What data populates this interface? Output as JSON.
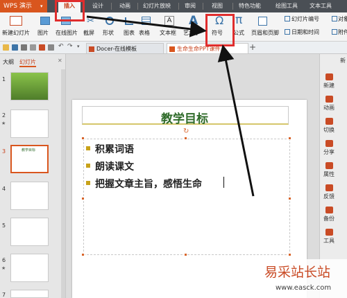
{
  "app": {
    "name": "WPS 演示",
    "dropdown": "▾"
  },
  "ribbon_tabs": [
    "插入",
    "设计",
    "动画",
    "幻灯片放映",
    "审阅",
    "视图",
    "特色功能",
    "绘图工具",
    "文本工具"
  ],
  "ribbon": {
    "new_slide": "新建幻灯片",
    "image": "图片",
    "online_image": "在线图片",
    "screenshot": "截屏",
    "shape": "形状",
    "chart": "图表",
    "table": "表格",
    "textbox": "文本框",
    "art": "艺术字",
    "symbol": "符号",
    "formula": "公式",
    "header_footer": "页眉和页脚",
    "slide_number": "幻灯片编号",
    "date_time": "日期和时间",
    "object": "对象",
    "attachment": "附件"
  },
  "doc_tabs": [
    "Docer-在线模板",
    "生命生命PPT课件..."
  ],
  "left_panel": {
    "tabs": [
      "大纲",
      "幻灯片"
    ],
    "slide_numbers": [
      "1",
      "2",
      "3",
      "4",
      "5",
      "6",
      "7"
    ],
    "thumb3_title": "教学目标"
  },
  "slide": {
    "title": "教学目标",
    "bullets": [
      "积累词语",
      "朗读课文",
      "把握文章主旨，感悟生命"
    ]
  },
  "right_panel": {
    "tab": "新",
    "items": [
      "新建",
      "动画",
      "切换",
      "分享",
      "属性",
      "反馈",
      "备份",
      "工具"
    ]
  },
  "watermark": {
    "line1": "易采站长站",
    "line2": "www.easck.com"
  },
  "colors": {
    "accent": "#d9561e",
    "title_green": "#2f6b2a",
    "annotation_red": "#e02d2d"
  }
}
